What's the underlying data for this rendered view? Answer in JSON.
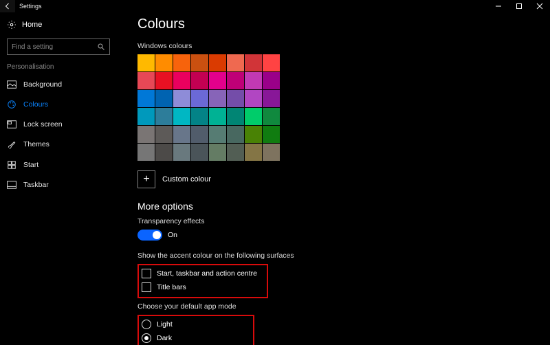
{
  "titlebar": {
    "app_title": "Settings"
  },
  "sidebar": {
    "home_label": "Home",
    "search_placeholder": "Find a setting",
    "section_heading": "Personalisation",
    "items": [
      {
        "label": "Background"
      },
      {
        "label": "Colours"
      },
      {
        "label": "Lock screen"
      },
      {
        "label": "Themes"
      },
      {
        "label": "Start"
      },
      {
        "label": "Taskbar"
      }
    ]
  },
  "page": {
    "title": "Colours",
    "swatch_heading": "Windows colours",
    "swatches": [
      "#FFB900",
      "#FF8C00",
      "#F7630C",
      "#CA5010",
      "#DA3B01",
      "#EF6950",
      "#D13438",
      "#FF4343",
      "#E74856",
      "#E81123",
      "#EA005E",
      "#C30052",
      "#E3008C",
      "#BF0077",
      "#C239B3",
      "#9A0089",
      "#0078D7",
      "#0063B1",
      "#8E8CD8",
      "#6B69D6",
      "#8764B8",
      "#744DA9",
      "#B146C2",
      "#881798",
      "#0099BC",
      "#2D7D9A",
      "#00B7C3",
      "#038387",
      "#00B294",
      "#018574",
      "#00CC6A",
      "#10893E",
      "#7A7574",
      "#5D5A58",
      "#68768A",
      "#515C6B",
      "#567C73",
      "#486860",
      "#498205",
      "#107C10",
      "#767676",
      "#4C4A48",
      "#69797E",
      "#4A5459",
      "#647C64",
      "#525E54",
      "#847545",
      "#7E735F"
    ],
    "custom_colour_label": "Custom colour",
    "more_options_heading": "More options",
    "transparency": {
      "label": "Transparency effects",
      "state": "On"
    },
    "accent_surfaces": {
      "label": "Show the accent colour on the following surfaces",
      "options": [
        "Start, taskbar and action centre",
        "Title bars"
      ]
    },
    "app_mode": {
      "label": "Choose your default app mode",
      "options": [
        "Light",
        "Dark"
      ],
      "selected": "Dark"
    }
  }
}
